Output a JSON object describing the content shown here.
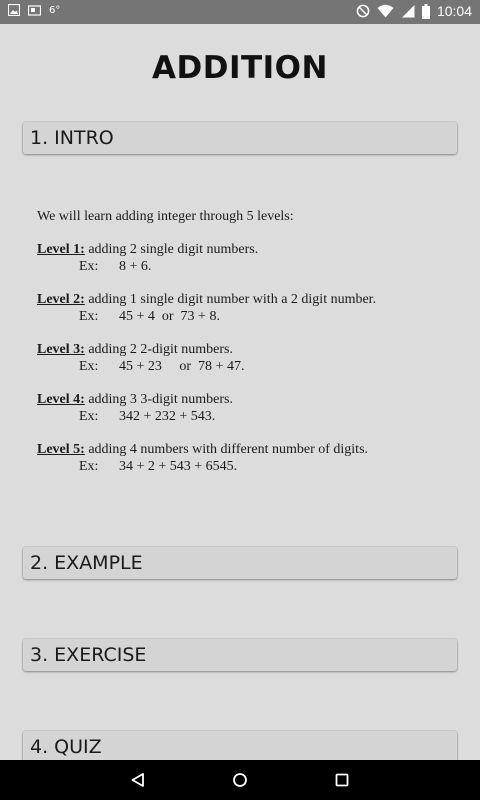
{
  "status_bar": {
    "temperature": "6°",
    "time": "10:04",
    "colors": {
      "background": "#757575",
      "foreground": "#ffffff"
    },
    "icons": [
      "image-icon",
      "photo-icon",
      "do-not-disturb-icon",
      "wifi-icon",
      "signal-icon",
      "battery-icon"
    ]
  },
  "page": {
    "title": "ADDITION",
    "background": "#dcdcdc"
  },
  "sections": {
    "intro": "1. INTRO",
    "example": "2. EXAMPLE",
    "exercise": "3. EXERCISE",
    "quiz": "4. QUIZ"
  },
  "intro": {
    "lead": "We will learn adding integer through 5 levels:",
    "levels": [
      {
        "title": "Level 1:",
        "desc": "adding 2 single digit numbers.",
        "ex_label": "Ex:",
        "example": "8 + 6."
      },
      {
        "title": "Level 2:",
        "desc": "adding 1 single digit number with a 2 digit number.",
        "ex_label": "Ex:",
        "example": "45 + 4  or  73 + 8."
      },
      {
        "title": "Level 3:",
        "desc": "adding 2 2-digit numbers.",
        "ex_label": "Ex:",
        "example": "45 + 23     or  78 + 47."
      },
      {
        "title": "Level 4:",
        "desc": "adding 3 3-digit numbers.",
        "ex_label": "Ex:",
        "example": "342 + 232 + 543."
      },
      {
        "title": "Level 5:",
        "desc": "adding 4 numbers with different number of digits.",
        "ex_label": "Ex:",
        "example": "34 + 2 + 543 + 6545."
      }
    ]
  },
  "nav_bar": {
    "icons": [
      "back-icon",
      "home-icon",
      "recents-icon"
    ],
    "background": "#000000"
  }
}
